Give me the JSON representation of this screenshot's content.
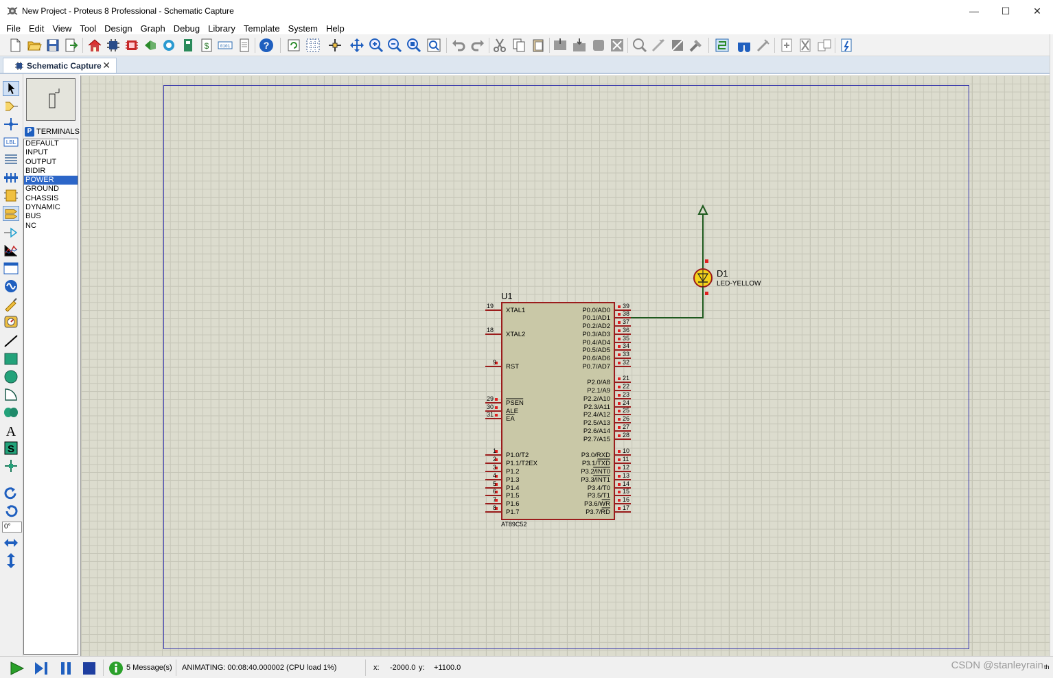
{
  "window": {
    "title": "New Project - Proteus 8 Professional - Schematic Capture",
    "controls": [
      "—",
      "☐",
      "✕"
    ]
  },
  "menu": [
    "File",
    "Edit",
    "View",
    "Tool",
    "Design",
    "Graph",
    "Debug",
    "Library",
    "Template",
    "System",
    "Help"
  ],
  "tab": {
    "label": "Schematic Capture",
    "close": "✕"
  },
  "device_panel": {
    "mode_button": "P",
    "header": "TERMINALS",
    "items": [
      "DEFAULT",
      "INPUT",
      "OUTPUT",
      "BIDIR",
      "POWER",
      "GROUND",
      "CHASSIS",
      "DYNAMIC",
      "BUS",
      "NC"
    ],
    "selected": "POWER"
  },
  "rotation": "0°",
  "schematic": {
    "u1": {
      "ref": "U1",
      "part": "AT89C52",
      "left_pins": [
        {
          "num": "19",
          "name": "XTAL1"
        },
        {
          "num": "18",
          "name": "XTAL2"
        },
        {
          "num": "9",
          "name": "RST"
        },
        {
          "num": "29",
          "name": "PSEN"
        },
        {
          "num": "30",
          "name": "ALE"
        },
        {
          "num": "31",
          "name": "EA"
        },
        {
          "num": "1",
          "name": "P1.0/T2"
        },
        {
          "num": "2",
          "name": "P1.1/T2EX"
        },
        {
          "num": "3",
          "name": "P1.2"
        },
        {
          "num": "4",
          "name": "P1.3"
        },
        {
          "num": "5",
          "name": "P1.4"
        },
        {
          "num": "6",
          "name": "P1.5"
        },
        {
          "num": "7",
          "name": "P1.6"
        },
        {
          "num": "8",
          "name": "P1.7"
        }
      ],
      "right_pins": [
        {
          "num": "39",
          "name": "P0.0/AD0"
        },
        {
          "num": "38",
          "name": "P0.1/AD1"
        },
        {
          "num": "37",
          "name": "P0.2/AD2"
        },
        {
          "num": "36",
          "name": "P0.3/AD3"
        },
        {
          "num": "35",
          "name": "P0.4/AD4"
        },
        {
          "num": "34",
          "name": "P0.5/AD5"
        },
        {
          "num": "33",
          "name": "P0.6/AD6"
        },
        {
          "num": "32",
          "name": "P0.7/AD7"
        },
        {
          "num": "21",
          "name": "P2.0/A8"
        },
        {
          "num": "22",
          "name": "P2.1/A9"
        },
        {
          "num": "23",
          "name": "P2.2/A10"
        },
        {
          "num": "24",
          "name": "P2.3/A11"
        },
        {
          "num": "25",
          "name": "P2.4/A12"
        },
        {
          "num": "26",
          "name": "P2.5/A13"
        },
        {
          "num": "27",
          "name": "P2.6/A14"
        },
        {
          "num": "28",
          "name": "P2.7/A15"
        },
        {
          "num": "10",
          "name": "P3.0/RXD"
        },
        {
          "num": "11",
          "name": "P3.1/TXD"
        },
        {
          "num": "12",
          "name": "P3.2/INT0"
        },
        {
          "num": "13",
          "name": "P3.3/INT1"
        },
        {
          "num": "14",
          "name": "P3.4/T0"
        },
        {
          "num": "15",
          "name": "P3.5/T1"
        },
        {
          "num": "16",
          "name": "P3.6/WR"
        },
        {
          "num": "17",
          "name": "P3.7/RD"
        }
      ]
    },
    "d1": {
      "ref": "D1",
      "part": "LED-YELLOW"
    }
  },
  "status": {
    "messages": "5 Message(s)",
    "animating": "ANIMATING: 00:08:40.000002 (CPU load 1%)",
    "x_label": "x:",
    "x_value": "-2000.0",
    "y_label": "y:",
    "y_value": "+1100.0",
    "right_text": "th"
  },
  "watermark": "CSDN @stanleyrain",
  "colors": {
    "sheet_bg": "#dcdcce",
    "component_fill": "#c9c8a7",
    "component_outline": "#9b1c1c",
    "wire": "#1e5a1e",
    "pin_marker": "#e02020",
    "led_fill": "#f4d21a",
    "selection": "#2c66c8"
  }
}
